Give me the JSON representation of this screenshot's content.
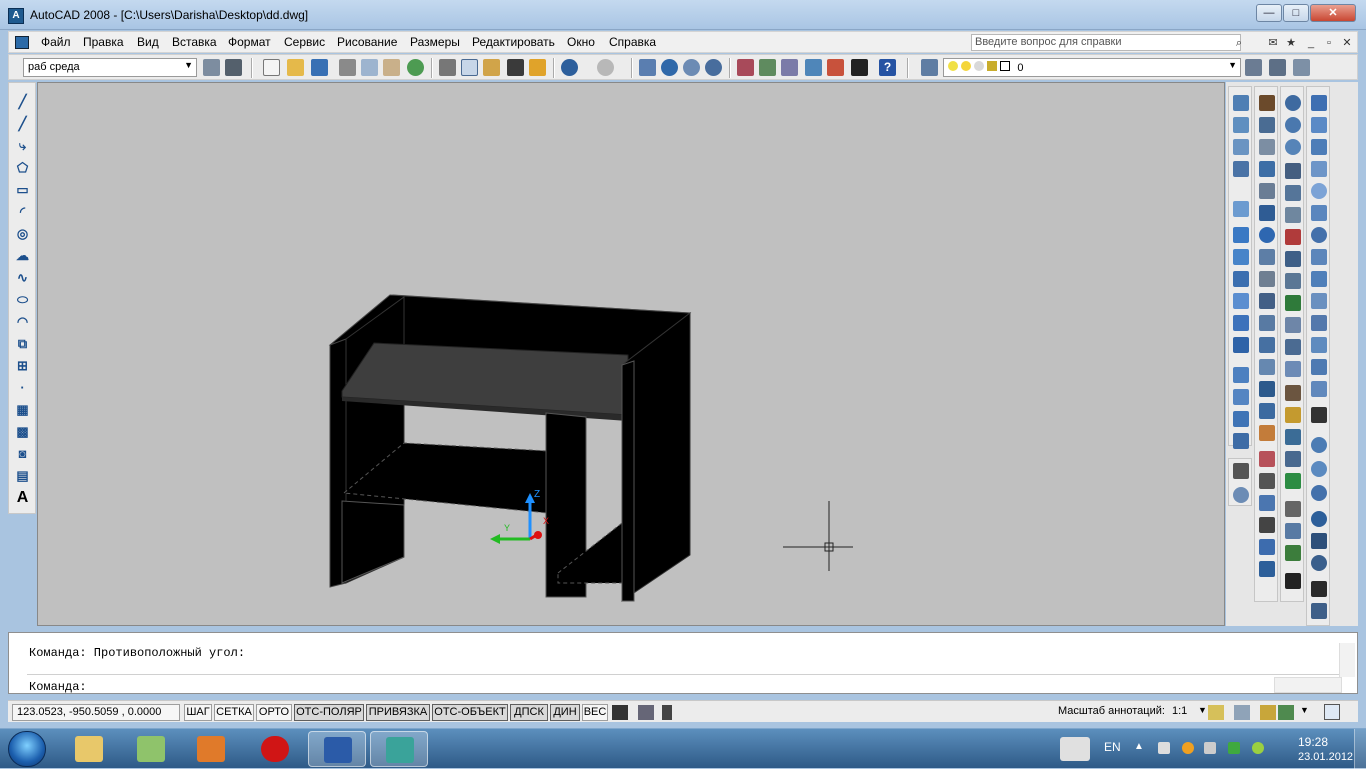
{
  "window": {
    "title": "AutoCAD 2008 - [C:\\Users\\Darisha\\Desktop\\dd.dwg]"
  },
  "menu": {
    "items": [
      "Файл",
      "Правка",
      "Вид",
      "Вставка",
      "Формат",
      "Сервис",
      "Рисование",
      "Размеры",
      "Редактировать",
      "Окно",
      "Справка"
    ],
    "help_placeholder": "Введите вопрос для справки"
  },
  "toolbar": {
    "workspace": "раб среда",
    "layer": "0"
  },
  "viewport": {
    "background": "#c0c0c0",
    "ucs": {
      "z_label": "Z",
      "y_label": "Y",
      "x_label": "X"
    }
  },
  "command": {
    "line1": "Команда: Противоположный угол:",
    "line2": "Команда:"
  },
  "status": {
    "coords": "123.0523,   -950.5059 , 0.0000",
    "buttons": [
      "ШАГ",
      "СЕТКА",
      "ОРТО",
      "ОТС-ПОЛЯР",
      "ПРИВЯЗКА",
      "ОТС-ОБЪЕКТ",
      "ДПСК",
      "ДИН",
      "ВЕС"
    ],
    "annotation_label": "Масштаб аннотаций:",
    "annotation_value": "1:1"
  },
  "taskbar": {
    "language": "EN",
    "time": "19:28",
    "date": "23.01.2012"
  },
  "colors": {
    "accent": "#1f5a8f",
    "viewport_bg": "#c0c0c0",
    "ucs_z": "#1e90ff",
    "ucs_x": "#dd1111",
    "ucs_y": "#22bb22"
  }
}
